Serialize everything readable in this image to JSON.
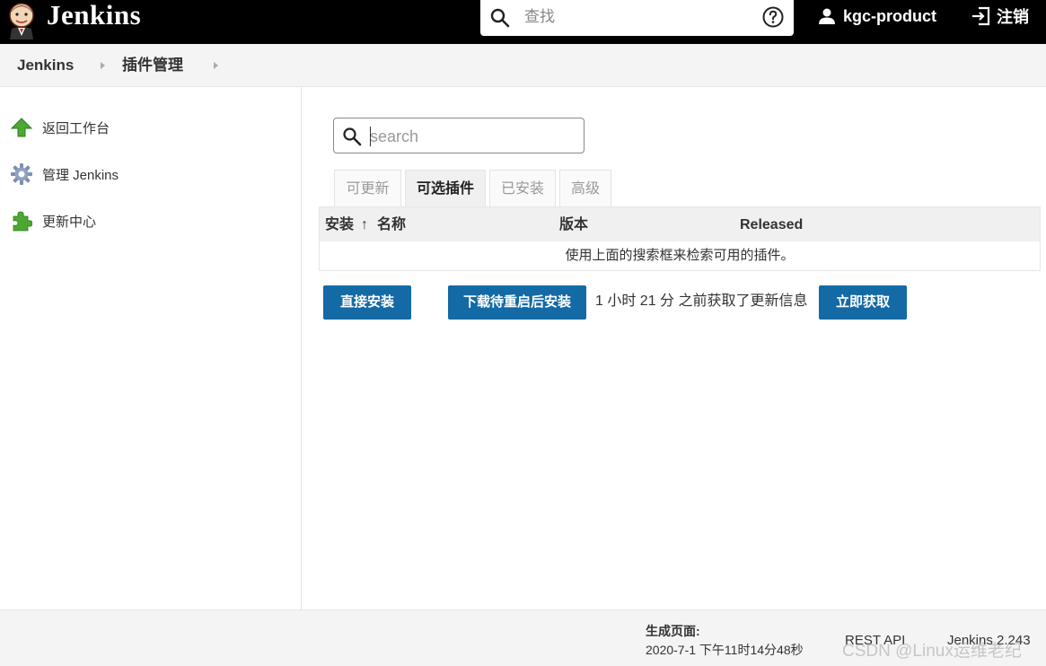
{
  "header": {
    "brand": "Jenkins",
    "search_placeholder": "查找",
    "user": "kgc-product",
    "logout": "注销"
  },
  "breadcrumb": {
    "items": [
      "Jenkins",
      "插件管理"
    ]
  },
  "sidebar": {
    "items": [
      {
        "label": "返回工作台",
        "icon": "up-arrow-icon"
      },
      {
        "label": "管理 Jenkins",
        "icon": "gear-icon"
      },
      {
        "label": "更新中心",
        "icon": "puzzle-icon"
      }
    ]
  },
  "main": {
    "search_placeholder": "search",
    "tabs": [
      {
        "label": "可更新",
        "active": false
      },
      {
        "label": "可选插件",
        "active": true
      },
      {
        "label": "已安装",
        "active": false
      },
      {
        "label": "高级",
        "active": false
      }
    ],
    "table": {
      "col_install": "安装",
      "sort_arrow": "↑",
      "col_name": "名称",
      "col_version": "版本",
      "col_released": "Released",
      "empty_message": "使用上面的搜索框来检索可用的插件。"
    },
    "buttons": {
      "install_now": "直接安装",
      "download_restart": "下载待重启后安装",
      "fetch_now": "立即获取"
    },
    "update_info": "1 小时 21 分 之前获取了更新信息"
  },
  "footer": {
    "generated_label": "生成页面:",
    "generated_time": "2020-7-1 下午11时14分48秒",
    "rest_api": "REST API",
    "version": "Jenkins 2.243",
    "watermark": "CSDN @Linux运维老纪"
  },
  "colors": {
    "header_bg": "#000000",
    "button_blue": "#136aa5",
    "breadcrumb_bg": "#f4f4f4"
  }
}
